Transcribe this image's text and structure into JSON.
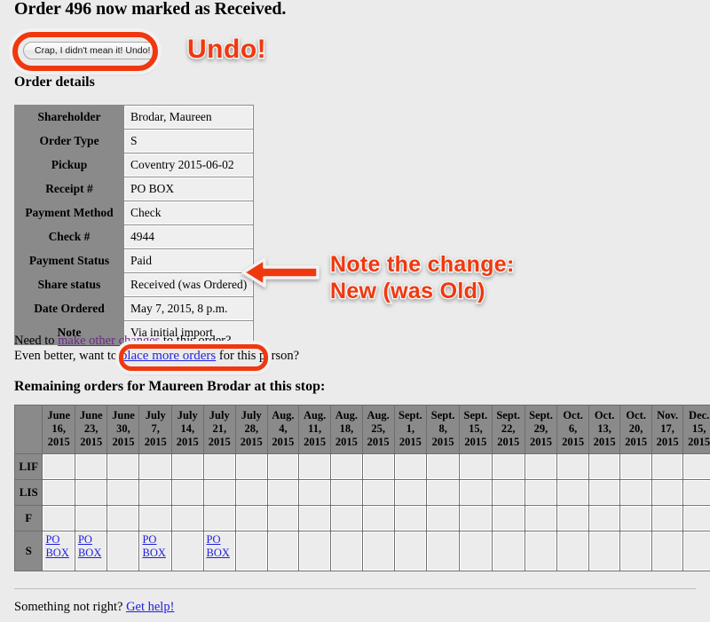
{
  "page": {
    "heading": "Order 496 now marked as Received.",
    "order_details_heading": "Order details",
    "remaining_heading": "Remaining orders for Maureen Brodar at this stop:"
  },
  "undo": {
    "button_label": "Crap, I didn't mean it! Undo!",
    "annotation": "Undo!"
  },
  "annotations": {
    "note_line1": "Note the change:",
    "note_line2": "New (was Old)",
    "arrow_icon": "arrow-left-icon",
    "highlight_color": "#f0380f"
  },
  "order_details": {
    "rows": [
      {
        "label": "Shareholder",
        "value": "Brodar, Maureen"
      },
      {
        "label": "Order Type",
        "value": "S"
      },
      {
        "label": "Pickup",
        "value": "Coventry 2015-06-02"
      },
      {
        "label": "Receipt #",
        "value": "PO BOX"
      },
      {
        "label": "Payment Method",
        "value": "Check"
      },
      {
        "label": "Check #",
        "value": "4944"
      },
      {
        "label": "Payment Status",
        "value": "Paid"
      },
      {
        "label": "Share status",
        "value": "Received (was Ordered)"
      },
      {
        "label": "Date Ordered",
        "value": "May 7, 2015, 8 p.m."
      },
      {
        "label": "Note",
        "value": "Via initial import"
      }
    ]
  },
  "links_section": {
    "line1_prefix": "Need to ",
    "line1_link": "make other changes",
    "line1_suffix": " to this order?",
    "line2_prefix": "Even better, want to ",
    "line2_link": "place more orders",
    "line2_suffix": " for this person?"
  },
  "grid": {
    "date_columns": [
      [
        "June",
        "16,",
        "2015"
      ],
      [
        "June",
        "23,",
        "2015"
      ],
      [
        "June",
        "30,",
        "2015"
      ],
      [
        "July",
        "7,",
        "2015"
      ],
      [
        "July",
        "14,",
        "2015"
      ],
      [
        "July",
        "21,",
        "2015"
      ],
      [
        "July",
        "28,",
        "2015"
      ],
      [
        "Aug.",
        "4,",
        "2015"
      ],
      [
        "Aug.",
        "11,",
        "2015"
      ],
      [
        "Aug.",
        "18,",
        "2015"
      ],
      [
        "Aug.",
        "25,",
        "2015"
      ],
      [
        "Sept.",
        "1,",
        "2015"
      ],
      [
        "Sept.",
        "8,",
        "2015"
      ],
      [
        "Sept.",
        "15,",
        "2015"
      ],
      [
        "Sept.",
        "22,",
        "2015"
      ],
      [
        "Sept.",
        "29,",
        "2015"
      ],
      [
        "Oct.",
        "6,",
        "2015"
      ],
      [
        "Oct.",
        "13,",
        "2015"
      ],
      [
        "Oct.",
        "20,",
        "2015"
      ],
      [
        "Nov.",
        "17,",
        "2015"
      ],
      [
        "Dec.",
        "15,",
        "2015"
      ]
    ],
    "row_labels": [
      "LIF",
      "LIS",
      "F",
      "S"
    ],
    "cell_link_label": "PO BOX",
    "cells": {
      "LIF": [],
      "LIS": [],
      "F": [],
      "S": [
        0,
        1,
        3,
        5
      ]
    }
  },
  "footer": {
    "prefix": "Something not right? ",
    "link": "Get help!"
  }
}
